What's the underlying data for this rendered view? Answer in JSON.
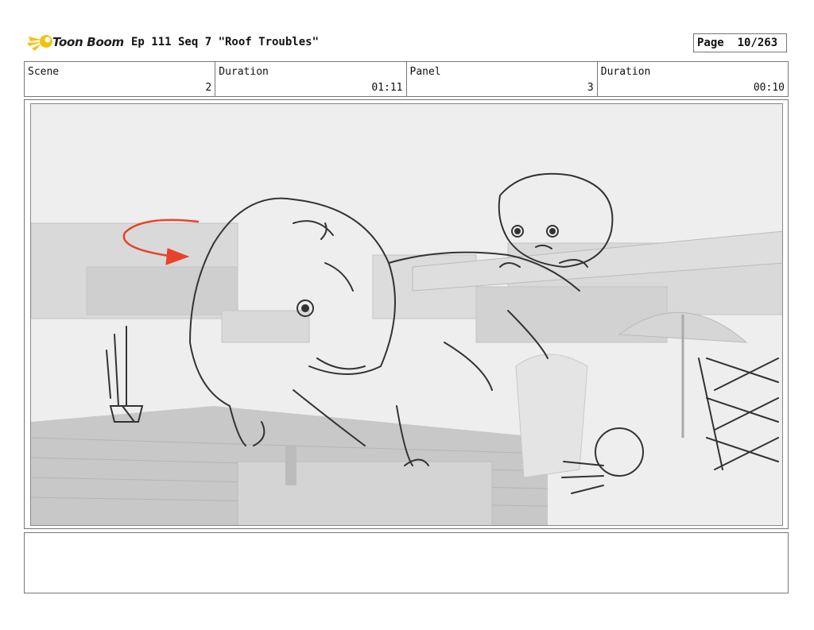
{
  "header": {
    "logo_text": "Toon Boom",
    "title": "Ep 111 Seq 7 \"Roof Troubles\"",
    "page_label": "Page",
    "page_value": "10/263"
  },
  "info": {
    "scene_label": "Scene",
    "scene_value": "2",
    "scene_duration_label": "Duration",
    "scene_duration_value": "01:11",
    "panel_label": "Panel",
    "panel_value": "3",
    "panel_duration_label": "Duration",
    "panel_duration_value": "00:10"
  },
  "panel": {
    "accent_color": "#e8432a",
    "background_color": "#eeeeee"
  },
  "notes": {
    "text": ""
  }
}
